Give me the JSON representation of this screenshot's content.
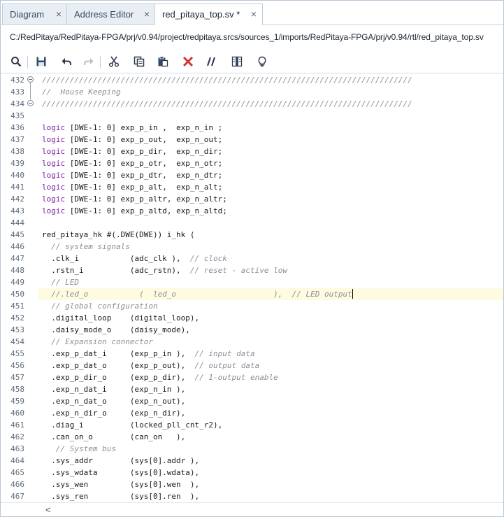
{
  "tabs": [
    {
      "label": "Diagram",
      "close": "×"
    },
    {
      "label": "Address Editor",
      "close": "×"
    },
    {
      "label": "red_pitaya_top.sv *",
      "close": "×"
    }
  ],
  "file_path": "C:/RedPitaya/RedPitaya-FPGA/prj/v0.94/project/redpitaya.srcs/sources_1/imports/RedPitaya-FPGA/prj/v0.94/rtl/red_pitaya_top.sv",
  "toolbar": {
    "icons": [
      "search-icon",
      "save-icon",
      "undo-icon",
      "redo-icon",
      "cut-icon",
      "copy-icon",
      "paste-icon",
      "delete-icon",
      "comment-icon",
      "toggle-columns-icon",
      "lightbulb-icon"
    ]
  },
  "code_lines": [
    {
      "n": "432",
      "t": "////////////////////////////////////////////////////////////////////////////////",
      "c": "cm"
    },
    {
      "n": "433",
      "t": "//  House Keeping",
      "c": "cm"
    },
    {
      "n": "434",
      "t": "////////////////////////////////////////////////////////////////////////////////",
      "c": "cm"
    },
    {
      "n": "435",
      "t": ""
    },
    {
      "n": "436",
      "kw": "logic",
      "t": " [DWE-1: 0] exp_p_in ,  exp_n_in ;"
    },
    {
      "n": "437",
      "kw": "logic",
      "t": " [DWE-1: 0] exp_p_out,  exp_n_out;"
    },
    {
      "n": "438",
      "kw": "logic",
      "t": " [DWE-1: 0] exp_p_dir,  exp_n_dir;"
    },
    {
      "n": "439",
      "kw": "logic",
      "t": " [DWE-1: 0] exp_p_otr,  exp_n_otr;"
    },
    {
      "n": "440",
      "kw": "logic",
      "t": " [DWE-1: 0] exp_p_dtr,  exp_n_dtr;"
    },
    {
      "n": "441",
      "kw": "logic",
      "t": " [DWE-1: 0] exp_p_alt,  exp_n_alt;"
    },
    {
      "n": "442",
      "kw": "logic",
      "t": " [DWE-1: 0] exp_p_altr, exp_n_altr;"
    },
    {
      "n": "443",
      "kw": "logic",
      "t": " [DWE-1: 0] exp_p_altd, exp_n_altd;"
    },
    {
      "n": "444",
      "t": ""
    },
    {
      "n": "445",
      "t": "red_pitaya_hk #(.DWE(DWE)) i_hk ("
    },
    {
      "n": "446",
      "t": "  // system signals",
      "c": "cm"
    },
    {
      "n": "447",
      "t": "  .clk_i           (adc_clk ),  ",
      "cm": "// clock"
    },
    {
      "n": "448",
      "t": "  .rstn_i          (adc_rstn),  ",
      "cm": "// reset - active low"
    },
    {
      "n": "449",
      "t": "  // LED",
      "c": "cm"
    },
    {
      "n": "450",
      "t": "  //.led_o           (  led_o                     ),  // LED output",
      "c": "cm",
      "hl": true,
      "caret": true
    },
    {
      "n": "451",
      "t": "  // global configuration",
      "c": "cm"
    },
    {
      "n": "452",
      "t": "  .digital_loop    (digital_loop),"
    },
    {
      "n": "453",
      "t": "  .daisy_mode_o    (daisy_mode),"
    },
    {
      "n": "454",
      "t": "  // Expansion connector",
      "c": "cm"
    },
    {
      "n": "455",
      "t": "  .exp_p_dat_i     (exp_p_in ),  ",
      "cm": "// input data"
    },
    {
      "n": "456",
      "t": "  .exp_p_dat_o     (exp_p_out),  ",
      "cm": "// output data"
    },
    {
      "n": "457",
      "t": "  .exp_p_dir_o     (exp_p_dir),  ",
      "cm": "// 1-output enable"
    },
    {
      "n": "458",
      "t": "  .exp_n_dat_i     (exp_n_in ),"
    },
    {
      "n": "459",
      "t": "  .exp_n_dat_o     (exp_n_out),"
    },
    {
      "n": "460",
      "t": "  .exp_n_dir_o     (exp_n_dir),"
    },
    {
      "n": "461",
      "t": "  .diag_i          (locked_pll_cnt_r2),"
    },
    {
      "n": "462",
      "t": "  .can_on_o        (can_on   ),"
    },
    {
      "n": "463",
      "t": "   // System bus",
      "c": "cm"
    },
    {
      "n": "464",
      "t": "  .sys_addr        (sys[0].addr ),"
    },
    {
      "n": "465",
      "t": "  .sys_wdata       (sys[0].wdata),"
    },
    {
      "n": "466",
      "t": "  .sys_wen         (sys[0].wen  ),"
    },
    {
      "n": "467",
      "t": "  .sys_ren         (sys[0].ren  ),"
    }
  ],
  "scroll_left_arrow": "<",
  "colors": {
    "keyword": "#7a1fa2",
    "comment": "#8a8f96",
    "highlight": "#fefbe1",
    "delete": "#d32f2f"
  }
}
